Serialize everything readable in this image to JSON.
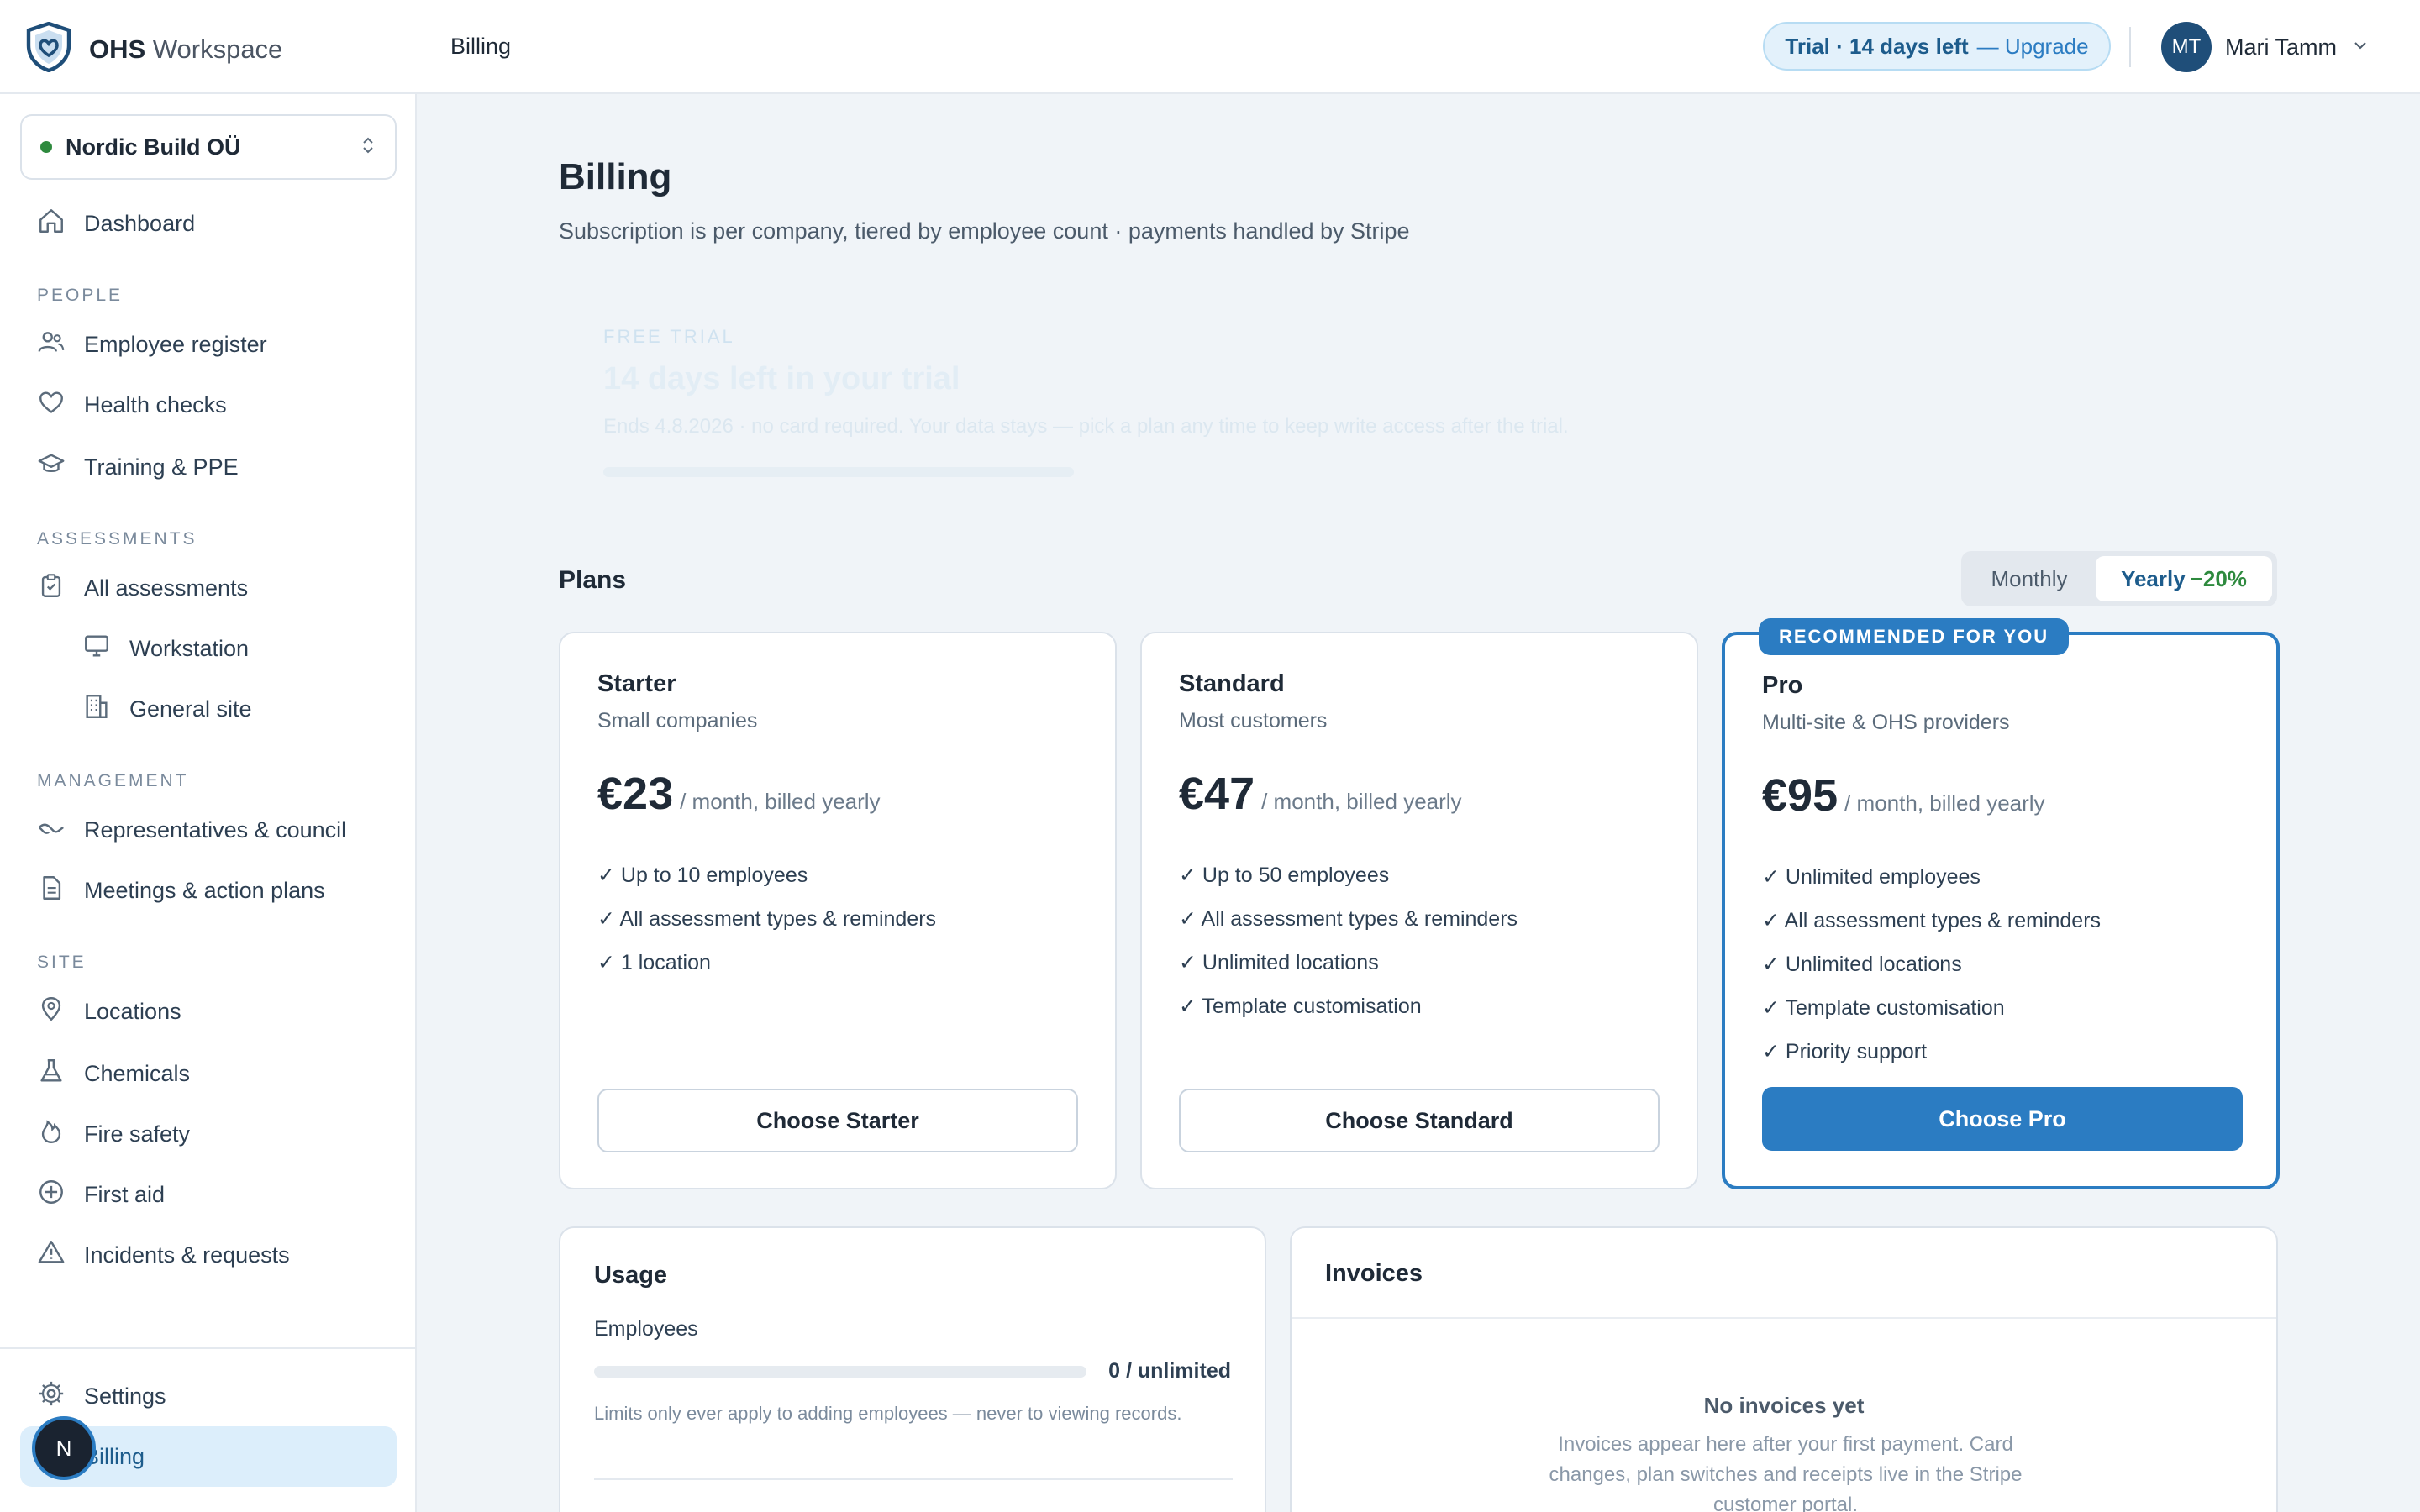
{
  "app": {
    "name_bold": "OHS",
    "name_rest": "Workspace"
  },
  "header": {
    "breadcrumb": "Billing",
    "trial_bold": "Trial · 14 days left",
    "trial_upgrade": "— Upgrade",
    "user_initials": "MT",
    "user_name": "Mari Tamm"
  },
  "sidebar": {
    "company": "Nordic Build OÜ",
    "dashboard": "Dashboard",
    "sections": {
      "people": "PEOPLE",
      "assessments": "ASSESSMENTS",
      "management": "MANAGEMENT",
      "site": "SITE"
    },
    "items": {
      "employee_register": "Employee register",
      "health_checks": "Health checks",
      "training_ppe": "Training & PPE",
      "all_assessments": "All assessments",
      "workstation": "Workstation",
      "general_site": "General site",
      "representatives": "Representatives & council",
      "meetings": "Meetings & action plans",
      "locations": "Locations",
      "chemicals": "Chemicals",
      "fire_safety": "Fire safety",
      "first_aid": "First aid",
      "incidents": "Incidents & requests",
      "settings": "Settings",
      "billing": "Billing"
    },
    "fab_initial": "N"
  },
  "page": {
    "title": "Billing",
    "subtitle": "Subscription is per company, tiered by employee count · payments handled by Stripe"
  },
  "trial_banner": {
    "eyebrow": "FREE TRIAL",
    "title": "14 days left in your trial",
    "text": "Ends 4.8.2026 · no card required. Your data stays — pick a plan any time to keep write access after the trial."
  },
  "plans": {
    "heading": "Plans",
    "toggle_monthly": "Monthly",
    "toggle_yearly": "Yearly",
    "toggle_discount": "−20%",
    "recommended_badge": "RECOMMENDED FOR YOU",
    "starter": {
      "name": "Starter",
      "desc": "Small companies",
      "price": "€23",
      "period": "/ month, billed yearly",
      "features": [
        "✓ Up to 10 employees",
        "✓ All assessment types & reminders",
        "✓ 1 location"
      ],
      "button": "Choose Starter"
    },
    "standard": {
      "name": "Standard",
      "desc": "Most customers",
      "price": "€47",
      "period": "/ month, billed yearly",
      "features": [
        "✓ Up to 50 employees",
        "✓ All assessment types & reminders",
        "✓ Unlimited locations",
        "✓ Template customisation"
      ],
      "button": "Choose Standard"
    },
    "pro": {
      "name": "Pro",
      "desc": "Multi-site & OHS providers",
      "price": "€95",
      "period": "/ month, billed yearly",
      "features": [
        "✓ Unlimited employees",
        "✓ All assessment types & reminders",
        "✓ Unlimited locations",
        "✓ Template customisation",
        "✓ Priority support"
      ],
      "button": "Choose Pro"
    }
  },
  "usage": {
    "heading": "Usage",
    "employees_label": "Employees",
    "employees_value": "0 / unlimited",
    "employees_fill": 0,
    "note": "Limits only ever apply to adding employees — never to viewing records."
  },
  "invoices": {
    "heading": "Invoices",
    "empty_title": "No invoices yet",
    "empty_text": "Invoices appear here after your first payment. Card changes, plan switches and receipts live in the Stripe customer portal."
  },
  "colors": {
    "accent": "#2b7cc2",
    "active_bg": "#dceefb",
    "status_green": "#2e8a3e"
  }
}
